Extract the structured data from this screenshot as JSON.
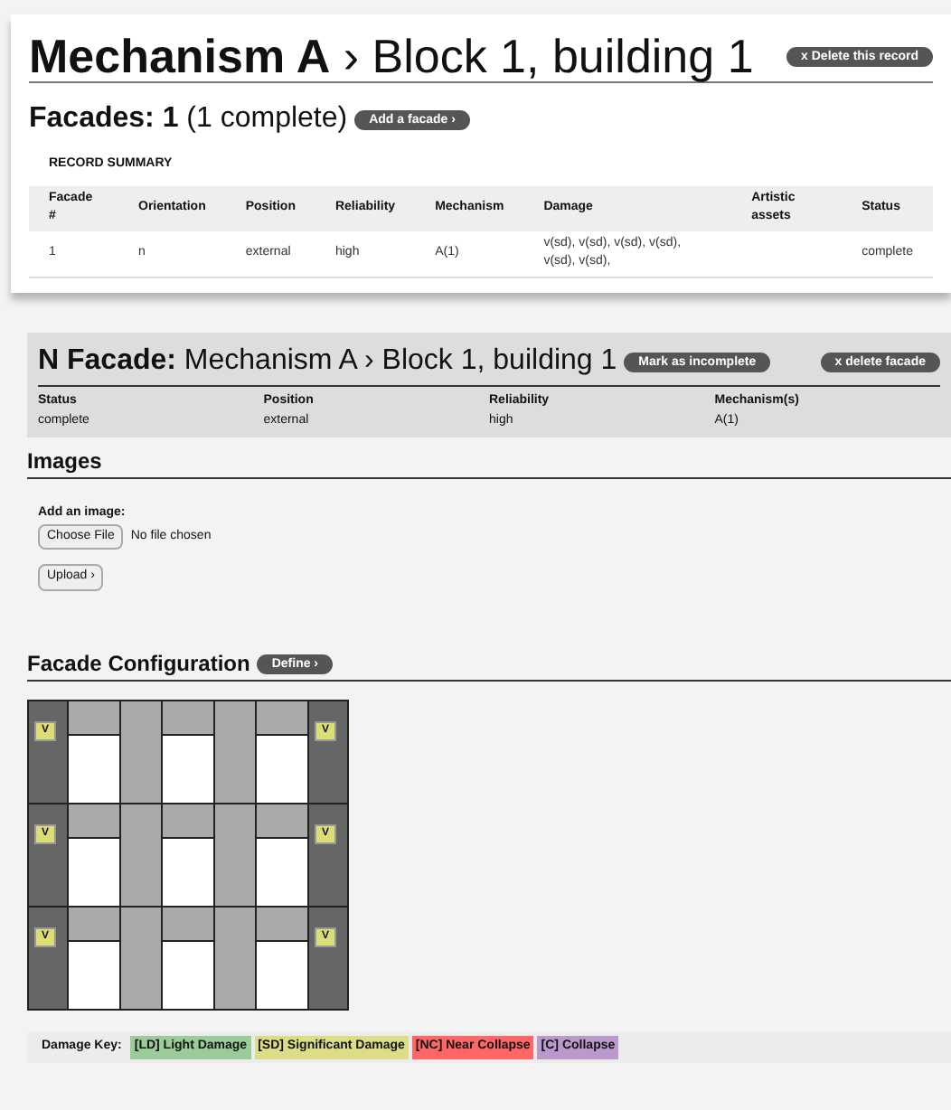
{
  "record": {
    "title_bold": "Mechanism A",
    "title_rest": "› Block 1, building 1",
    "delete_button": "x Delete this record"
  },
  "facades": {
    "label": "Facades: 1",
    "detail": "(1 complete)",
    "add_button": "Add a facade ›"
  },
  "summary": {
    "caption": "RECORD SUMMARY",
    "columns": [
      "Facade #",
      "Orientation",
      "Position",
      "Reliability",
      "Mechanism",
      "Damage",
      "Artistic assets",
      "Status"
    ],
    "rows": [
      [
        "1",
        "n",
        "external",
        "high",
        "A(1)",
        "v(sd), v(sd), v(sd), v(sd), v(sd), v(sd),",
        "",
        "complete"
      ]
    ]
  },
  "facade": {
    "title_bold": "N Facade:",
    "title_rest": "Mechanism A › Block 1, building 1",
    "mark_button": "Mark as incomplete",
    "delete_button": "x delete facade",
    "fields": [
      {
        "label": "Status",
        "value": "complete"
      },
      {
        "label": "Position",
        "value": "external"
      },
      {
        "label": "Reliability",
        "value": "high"
      },
      {
        "label": "Mechanism(s)",
        "value": "A(1)"
      }
    ]
  },
  "images": {
    "heading": "Images",
    "add_label": "Add an image:",
    "choose_button": "Choose File",
    "file_status": "No file chosen",
    "upload_button": "Upload ›"
  },
  "configuration": {
    "heading": "Facade Configuration",
    "define_button": "Define ›",
    "floors": [
      {
        "left_tag": "V",
        "right_tag": "V"
      },
      {
        "left_tag": "V",
        "right_tag": "V"
      },
      {
        "left_tag": "V",
        "right_tag": "V"
      }
    ]
  },
  "damage_key": {
    "label": "Damage Key:",
    "items": [
      {
        "text": "[LD] Light Damage",
        "color": "#99cc99"
      },
      {
        "text": "[SD] Significant Damage",
        "color": "#dddd88"
      },
      {
        "text": "[NC] Near Collapse",
        "color": "#ff6666"
      },
      {
        "text": "[C] Collapse",
        "color": "#bb99cc"
      }
    ]
  }
}
